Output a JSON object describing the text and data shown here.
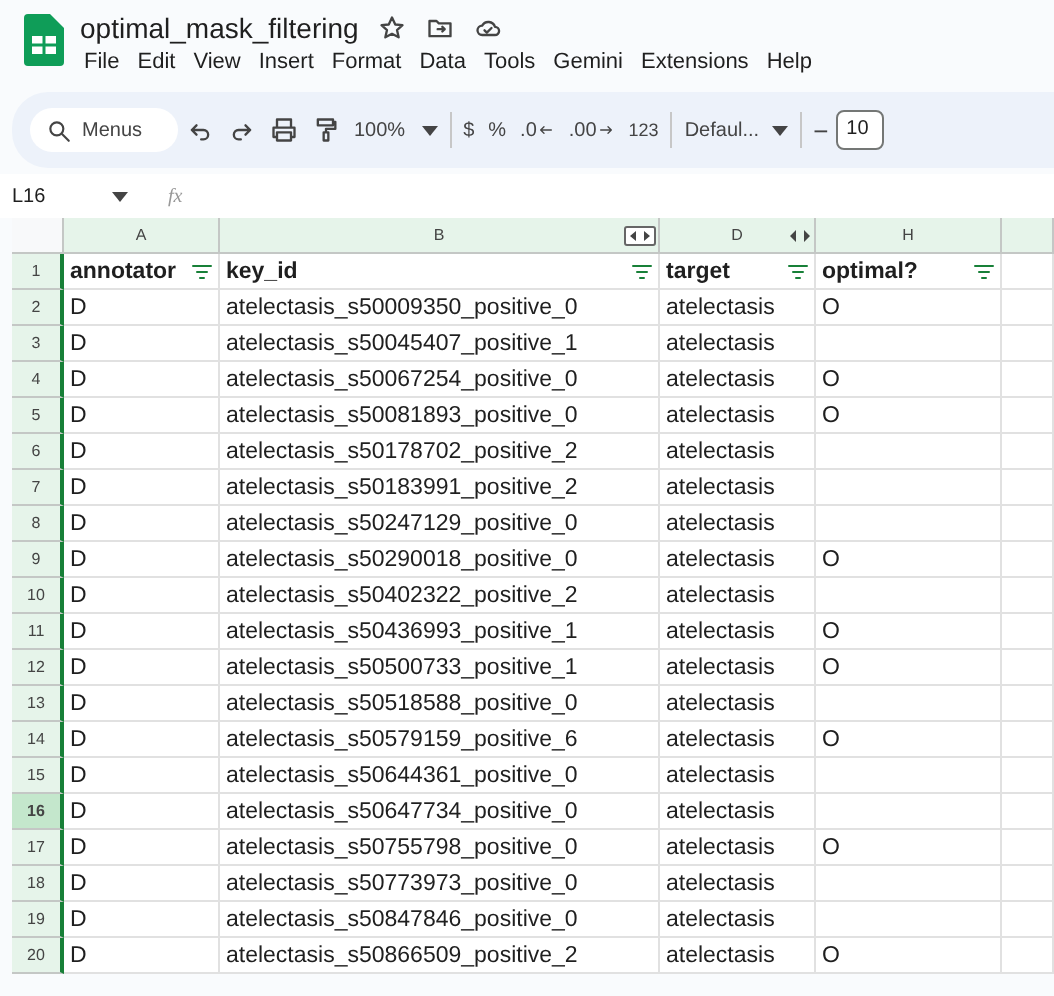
{
  "document": {
    "title": "optimal_mask_filtering"
  },
  "menu": [
    "File",
    "Edit",
    "View",
    "Insert",
    "Format",
    "Data",
    "Tools",
    "Gemini",
    "Extensions",
    "Help"
  ],
  "toolbar": {
    "search_placeholder": "Menus",
    "zoom": "100%",
    "currency": "$",
    "percent": "%",
    "decrease_decimal": ".0",
    "increase_decimal": ".00",
    "number_format": "123",
    "font": "Defaul...",
    "font_size_minus": "−",
    "font_size": "10"
  },
  "formula_bar": {
    "cell_ref": "L16",
    "fx": "fx"
  },
  "columns": [
    {
      "label": "A",
      "kind": "plain"
    },
    {
      "label": "B",
      "kind": "hidden-after"
    },
    {
      "label": "D",
      "kind": "hidden-after-split"
    },
    {
      "label": "H",
      "kind": "plain"
    }
  ],
  "header_row": {
    "number": "1",
    "cells": [
      "annotator",
      "key_id",
      "target",
      "optimal?"
    ]
  },
  "rows": [
    {
      "number": "2",
      "cells": [
        "D",
        "atelectasis_s50009350_positive_0",
        "atelectasis",
        "O"
      ],
      "selected": false
    },
    {
      "number": "3",
      "cells": [
        "D",
        "atelectasis_s50045407_positive_1",
        "atelectasis",
        ""
      ],
      "selected": false
    },
    {
      "number": "4",
      "cells": [
        "D",
        "atelectasis_s50067254_positive_0",
        "atelectasis",
        "O"
      ],
      "selected": false
    },
    {
      "number": "5",
      "cells": [
        "D",
        "atelectasis_s50081893_positive_0",
        "atelectasis",
        "O"
      ],
      "selected": false
    },
    {
      "number": "6",
      "cells": [
        "D",
        "atelectasis_s50178702_positive_2",
        "atelectasis",
        ""
      ],
      "selected": false
    },
    {
      "number": "7",
      "cells": [
        "D",
        "atelectasis_s50183991_positive_2",
        "atelectasis",
        ""
      ],
      "selected": false
    },
    {
      "number": "8",
      "cells": [
        "D",
        "atelectasis_s50247129_positive_0",
        "atelectasis",
        ""
      ],
      "selected": false
    },
    {
      "number": "9",
      "cells": [
        "D",
        "atelectasis_s50290018_positive_0",
        "atelectasis",
        "O"
      ],
      "selected": false
    },
    {
      "number": "10",
      "cells": [
        "D",
        "atelectasis_s50402322_positive_2",
        "atelectasis",
        ""
      ],
      "selected": false
    },
    {
      "number": "11",
      "cells": [
        "D",
        "atelectasis_s50436993_positive_1",
        "atelectasis",
        "O"
      ],
      "selected": false
    },
    {
      "number": "12",
      "cells": [
        "D",
        "atelectasis_s50500733_positive_1",
        "atelectasis",
        "O"
      ],
      "selected": false
    },
    {
      "number": "13",
      "cells": [
        "D",
        "atelectasis_s50518588_positive_0",
        "atelectasis",
        ""
      ],
      "selected": false
    },
    {
      "number": "14",
      "cells": [
        "D",
        "atelectasis_s50579159_positive_6",
        "atelectasis",
        "O"
      ],
      "selected": false
    },
    {
      "number": "15",
      "cells": [
        "D",
        "atelectasis_s50644361_positive_0",
        "atelectasis",
        ""
      ],
      "selected": false
    },
    {
      "number": "16",
      "cells": [
        "D",
        "atelectasis_s50647734_positive_0",
        "atelectasis",
        ""
      ],
      "selected": true
    },
    {
      "number": "17",
      "cells": [
        "D",
        "atelectasis_s50755798_positive_0",
        "atelectasis",
        "O"
      ],
      "selected": false
    },
    {
      "number": "18",
      "cells": [
        "D",
        "atelectasis_s50773973_positive_0",
        "atelectasis",
        ""
      ],
      "selected": false
    },
    {
      "number": "19",
      "cells": [
        "D",
        "atelectasis_s50847846_positive_0",
        "atelectasis",
        ""
      ],
      "selected": false
    },
    {
      "number": "20",
      "cells": [
        "D",
        "atelectasis_s50866509_positive_2",
        "atelectasis",
        "O"
      ],
      "selected": false
    }
  ]
}
